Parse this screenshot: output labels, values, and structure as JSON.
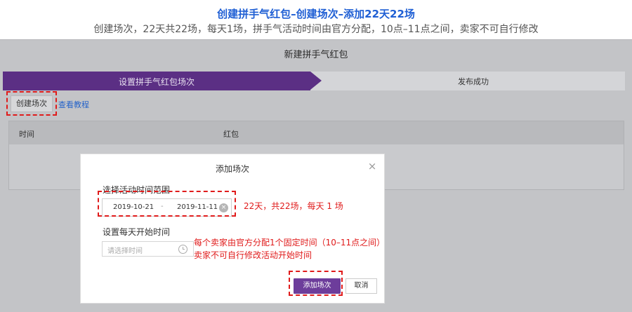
{
  "annotation": {
    "title": "创建拼手气红包–创建场次–添加22天22场",
    "subtitle": "创建场次，22天共22场，每天1场，拼手气活动时间由官方分配，10点–11点之间，卖家不可自行修改",
    "range_note": "22天，共22场，每天 1 场",
    "time_note_line1": "每个卖家由官方分配1个固定时间（10–11点之间）",
    "time_note_line2": "卖家不可自行修改活动开始时间",
    "accent_color": "#e01b1b"
  },
  "page": {
    "title": "新建拼手气红包"
  },
  "steps": [
    {
      "label": "设置拼手气红包场次",
      "active": true
    },
    {
      "label": "发布成功",
      "active": false
    }
  ],
  "toolbar": {
    "create_label": "创建场次",
    "tutorial_link": "查看教程"
  },
  "table": {
    "columns": [
      "时间",
      "红包"
    ]
  },
  "modal": {
    "title": "添加场次",
    "close_icon": "close-icon",
    "range_label": "选择活动时间范围",
    "range_start": "2019-10-21",
    "range_sep": "-",
    "range_end": "2019-11-11",
    "daily_label": "设置每天开始时间",
    "time_placeholder": "请选择时间",
    "add_label": "添加场次",
    "cancel_label": "取消"
  },
  "colors": {
    "brand_purple": "#5b2f84",
    "button_purple": "#6d3d9b",
    "link_blue": "#2563c9"
  }
}
